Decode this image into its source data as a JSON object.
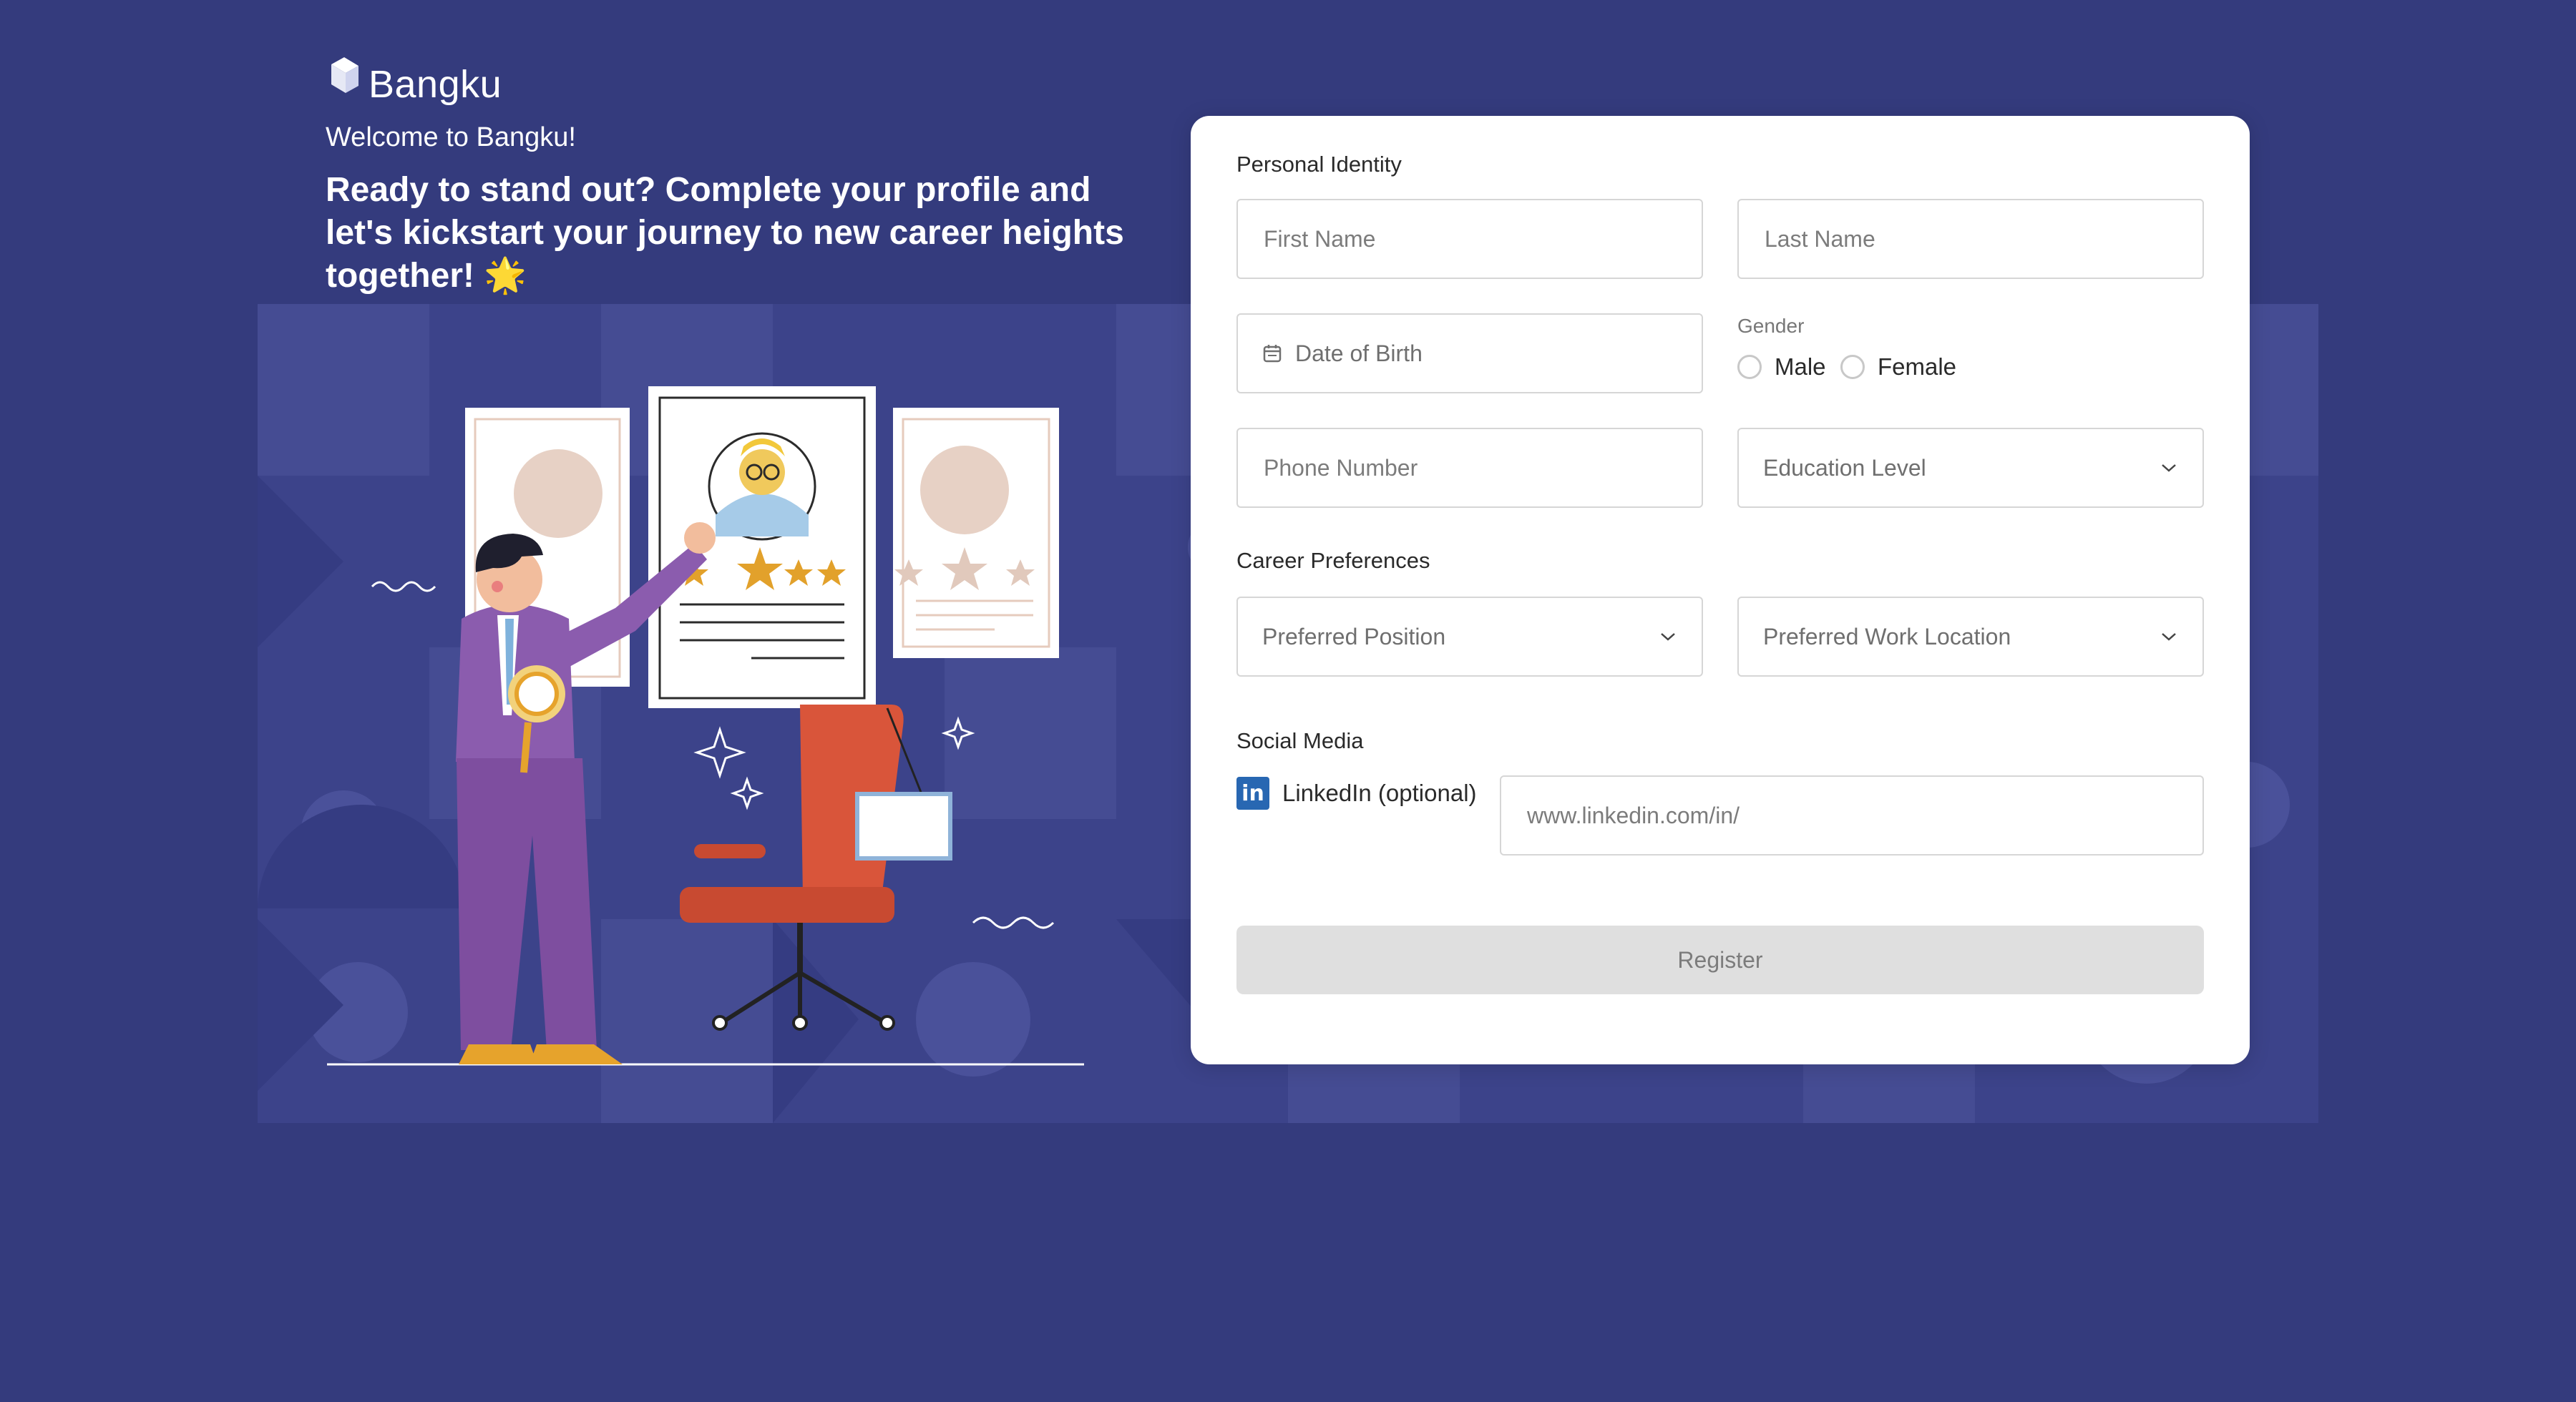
{
  "brand": {
    "name": "Bangku"
  },
  "hero": {
    "welcome": "Welcome to Bangku!",
    "headline": "Ready to stand out? Complete your profile and let's kickstart your journey to new career heights together!",
    "headline_emoji": "🌟"
  },
  "form": {
    "personal": {
      "title": "Personal Identity",
      "first_name": "First Name",
      "last_name": "Last Name",
      "dob": "Date of Birth",
      "gender_label": "Gender",
      "gender_options": [
        "Male",
        "Female"
      ],
      "phone": "Phone Number",
      "education": "Education Level"
    },
    "career": {
      "title": "Career Preferences",
      "position": "Preferred Position",
      "location": "Preferred Work Location"
    },
    "social": {
      "title": "Social Media",
      "linkedin_label": "LinkedIn (optional)",
      "linkedin_icon": "in",
      "linkedin_placeholder": "www.linkedin.com/in/"
    },
    "register_label": "Register"
  },
  "colors": {
    "background": "#343b7d",
    "pattern": "#3c438a",
    "card": "#ffffff",
    "linkedin": "#2867b2",
    "button_disabled": "#dfdfdf"
  }
}
